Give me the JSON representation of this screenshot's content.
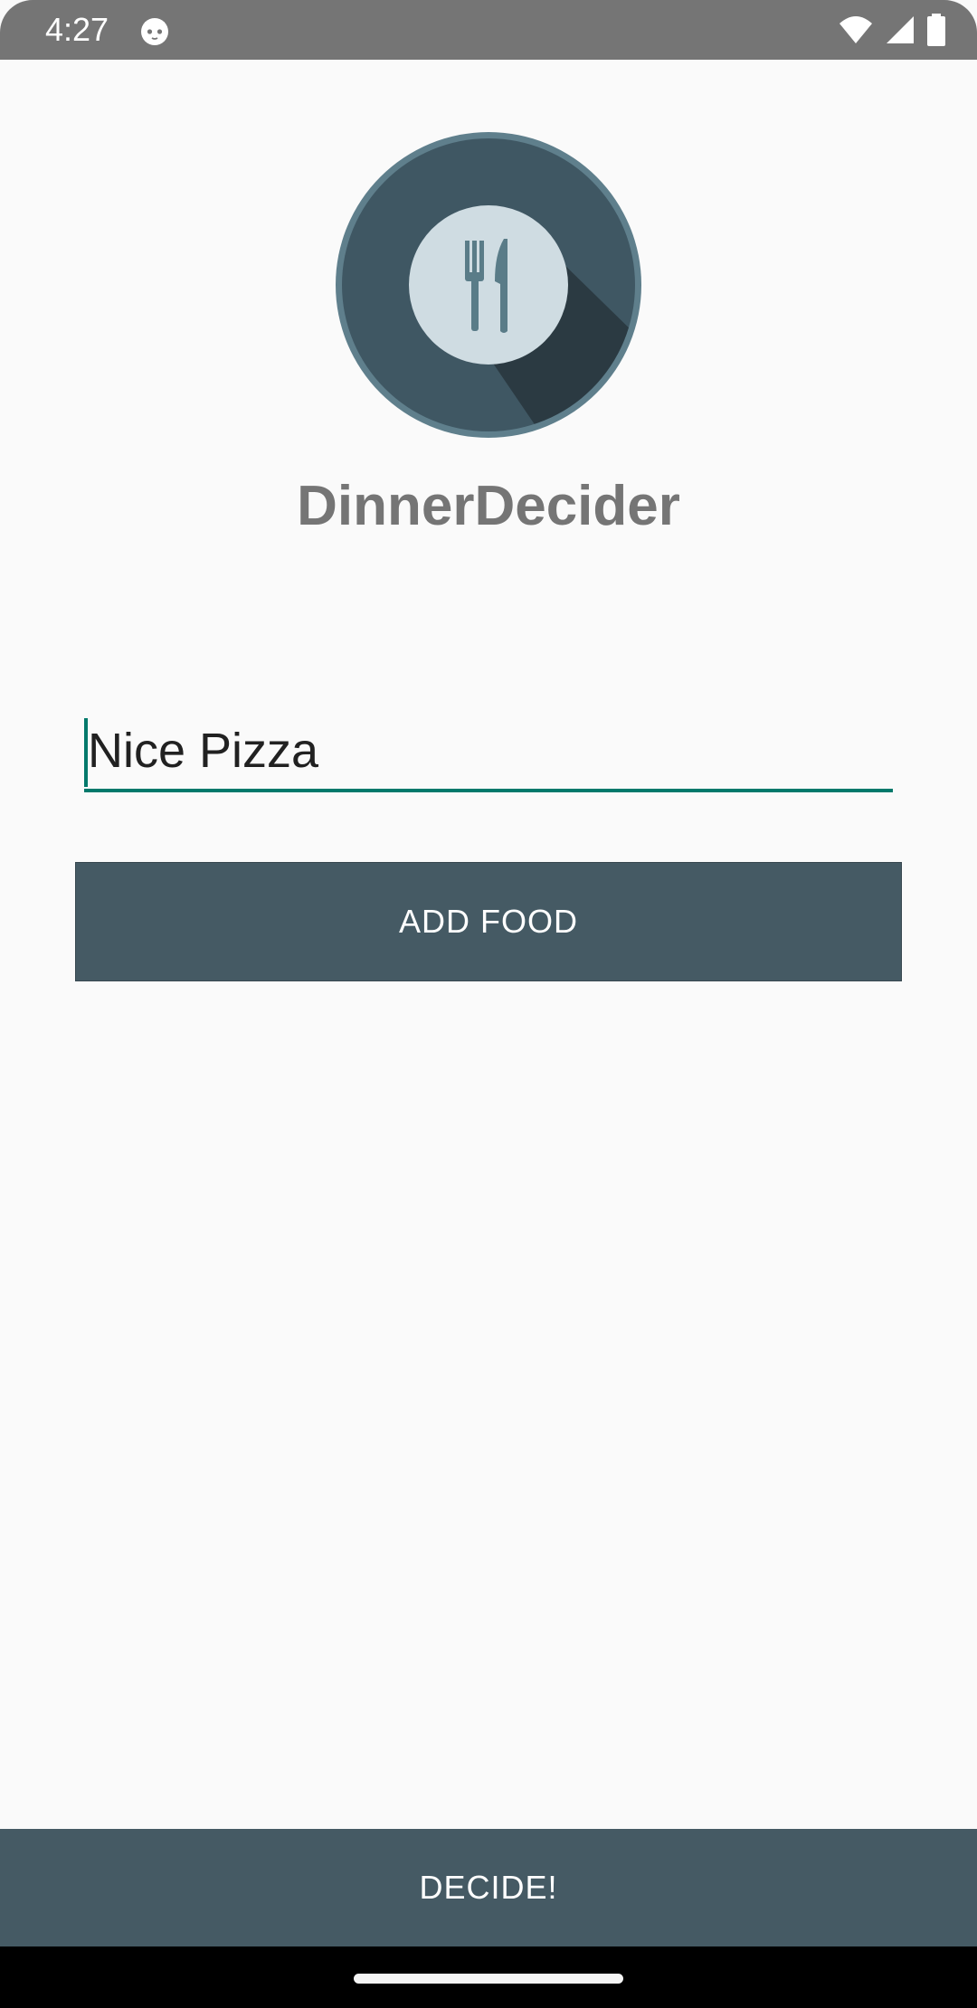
{
  "status_bar": {
    "time": "4:27",
    "icons": [
      "cat-notification-icon",
      "wifi-icon",
      "cell-signal-icon",
      "battery-icon"
    ]
  },
  "app": {
    "title": "DinnerDecider",
    "logo_icon": "fork-knife-icon"
  },
  "food_input": {
    "value": "Nice Pizza"
  },
  "buttons": {
    "add_food": "ADD FOOD",
    "decide": "DECIDE!"
  },
  "colors": {
    "primary": "#455a64",
    "accent": "#00796b",
    "status_bar": "#757575",
    "title": "#757575",
    "background": "#fafafa"
  }
}
